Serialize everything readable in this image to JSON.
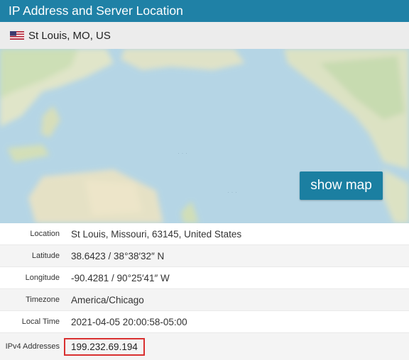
{
  "header": {
    "title": "IP Address and Server Location"
  },
  "location_bar": {
    "flag_icon": "us-flag-icon",
    "text": "St Louis, MO, US"
  },
  "map": {
    "button_label": "show map",
    "accent_color": "#1b7fa1"
  },
  "details": {
    "rows": [
      {
        "label": "Location",
        "value": "St Louis, Missouri, 63145, United States"
      },
      {
        "label": "Latitude",
        "value": "38.6423 / 38°38′32″ N"
      },
      {
        "label": "Longitude",
        "value": "-90.4281 / 90°25′41″ W"
      },
      {
        "label": "Timezone",
        "value": "America/Chicago"
      },
      {
        "label": "Local Time",
        "value": "2021-04-05 20:00:58-05:00"
      },
      {
        "label": "IPv4 Addresses",
        "value": "199.232.69.194"
      }
    ]
  },
  "colors": {
    "header_bg": "#1f81a6",
    "highlight_border": "#d93030"
  }
}
